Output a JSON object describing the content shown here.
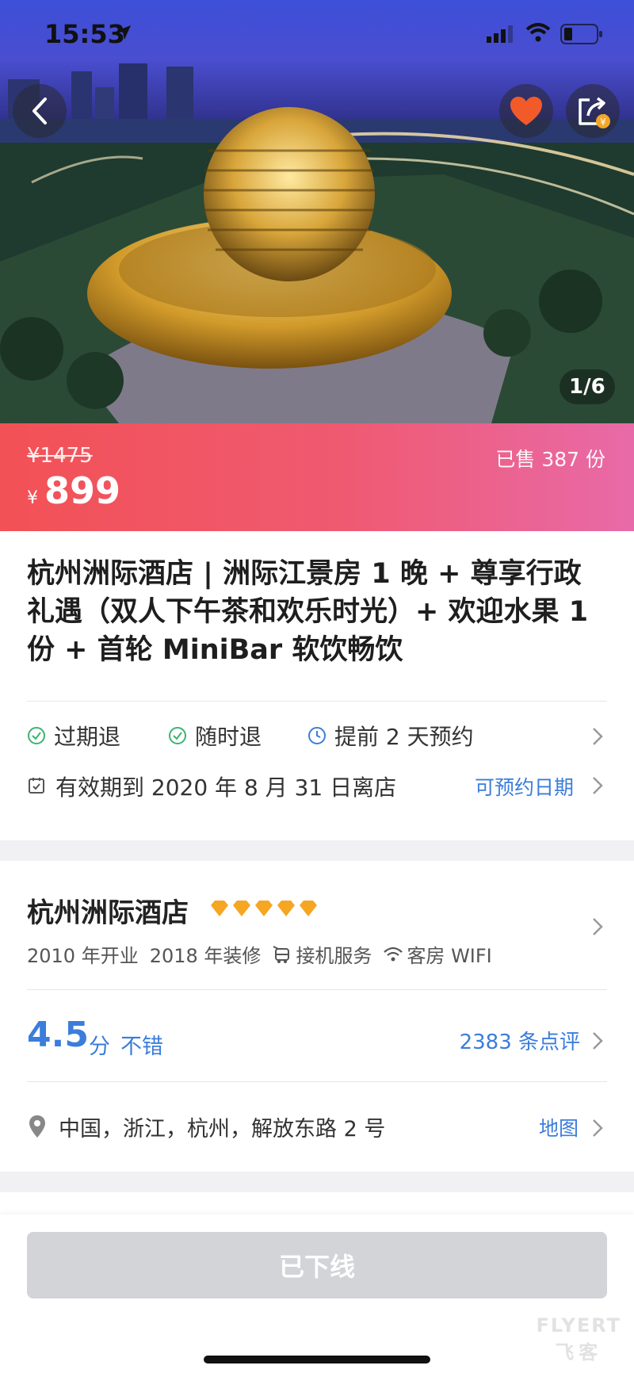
{
  "status_bar": {
    "time": "15:53"
  },
  "hero": {
    "photo_counter": "1/6"
  },
  "price": {
    "original": "¥1475",
    "currency_symbol": "¥",
    "current": "899",
    "sold": "已售 387 份",
    "gradient_colors": [
      "#f25155",
      "#e86aa8"
    ]
  },
  "product": {
    "title": "杭州洲际酒店 | 洲际江景房 1 晚 + 尊享行政礼遇（双人下午茶和欢乐时光）+ 欢迎水果 1 份 + 首轮 MiniBar 软饮畅饮"
  },
  "policies": [
    {
      "label": "过期退",
      "icon": "check-circle-icon"
    },
    {
      "label": "随时退",
      "icon": "check-circle-icon"
    },
    {
      "label": "提前 2 天预约",
      "icon": "clock-icon"
    }
  ],
  "validity": {
    "text": "有效期到 2020 年 8 月 31 日离店",
    "link": "可预约日期"
  },
  "hotel": {
    "name": "杭州洲际酒店",
    "star_count": 5,
    "opened": "2010 年开业",
    "renovated": "2018 年装修",
    "service_pickup": "接机服务",
    "service_wifi": "客房 WIFI"
  },
  "rating": {
    "score": "4.5",
    "unit": "分",
    "word": "不错",
    "reviews": "2383 条点评"
  },
  "address": {
    "text": "中国，浙江，杭州，解放东路 2 号",
    "map_link": "地图"
  },
  "action": {
    "button_label": "已下线"
  },
  "watermark": {
    "line1": "FLYERT",
    "line2": "飞客"
  },
  "colors": {
    "accent": "#3b7ddb",
    "star": "#f5a623",
    "fav": "#f25a2a"
  }
}
